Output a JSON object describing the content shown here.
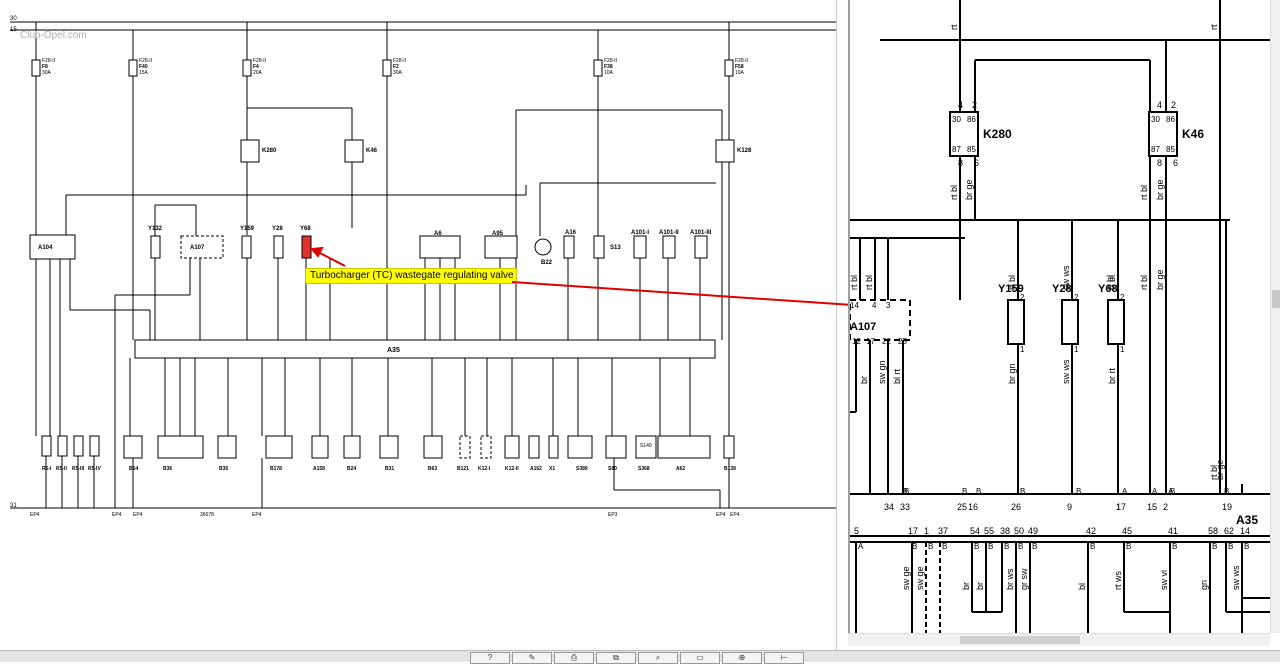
{
  "callout": {
    "text": "Turbocharger (TC) wastegate regulating valve",
    "color": "#ffff00",
    "arrow_color": "#e00000"
  },
  "watermark": "Club-Opel.com",
  "left": {
    "rails": [
      "30",
      "15"
    ],
    "ground_rail": "31",
    "fuses": [
      {
        "id": "F8",
        "sub": "30A",
        "top": "F28-II"
      },
      {
        "id": "F40",
        "sub": "15A",
        "top": "F28-II"
      },
      {
        "id": "F4",
        "sub": "20A",
        "top": "F28-II"
      },
      {
        "id": "F2",
        "sub": "30A",
        "top": "F28-II"
      },
      {
        "id": "F38",
        "sub": "10A",
        "top": "F28-II"
      },
      {
        "id": "F58",
        "sub": "10A",
        "top": "F28-II"
      }
    ],
    "relays": [
      "K280",
      "K46",
      "K128"
    ],
    "components": [
      "A104",
      "Y132",
      "A107",
      "Y159",
      "Y28",
      "Y68",
      "A6",
      "A95",
      "B22",
      "A16",
      "S13",
      "A101-I",
      "A101-II",
      "A101-III"
    ],
    "ecu": "A35",
    "bottom_components": [
      "R5-I",
      "R5-II",
      "R5-III",
      "R5-IV",
      "B64",
      "B36",
      "B35",
      "B178",
      "A158",
      "B24",
      "B31",
      "B63",
      "B121",
      "K12-I",
      "K12-II",
      "A162",
      "X1",
      "S389",
      "S80",
      "S368",
      "A62",
      "B138",
      "B64"
    ],
    "bottom_small": [
      "S149"
    ],
    "ground_labels": [
      "EP4",
      "EP4",
      "EP4",
      "EP4",
      "EP3",
      "EP4",
      "EP4"
    ],
    "misc_label": "36678"
  },
  "right": {
    "relays": [
      {
        "id": "K280",
        "pins": [
          "4",
          "2",
          "30",
          "86",
          "87",
          "85",
          "8",
          "6"
        ]
      },
      {
        "id": "K46",
        "pins": [
          "4",
          "2",
          "30",
          "86",
          "87",
          "85",
          "8",
          "6"
        ]
      }
    ],
    "wire_colors_top": [
      "rt",
      "rt"
    ],
    "wire_colors_mid": [
      "rt bl",
      "br ge",
      "rt bl",
      "br ge"
    ],
    "components": [
      {
        "id": "Y159",
        "top_pin": "2",
        "bottom_pin": "1",
        "wire_top": "rt bl",
        "wire_bottom": "br gn"
      },
      {
        "id": "Y28",
        "top_pin": "2",
        "bottom_pin": "1",
        "wire_top": "sw ws",
        "wire_bottom": "sw ws"
      },
      {
        "id": "Y68",
        "top_pin": "2",
        "bottom_pin": "1",
        "wire_top": "rt bl",
        "wire_bottom": "br rt"
      }
    ],
    "a107": {
      "id": "A107",
      "pins_top": [
        "14",
        "4",
        "3"
      ],
      "pins_bottom": [
        "12",
        "17",
        "22",
        "25"
      ]
    },
    "left_wires": [
      "rt bl",
      "rt bl",
      "br",
      "sw gn",
      "bl rt"
    ],
    "ecu": "A35",
    "ecu_row_top": [
      "34",
      "33",
      "25",
      "16",
      "26",
      "9",
      "17",
      "1",
      "15",
      "2",
      "19"
    ],
    "ecu_row_top_conn": [
      "B",
      "B",
      "B",
      "B",
      "B",
      "B",
      "A",
      "B",
      "A",
      "A",
      "B"
    ],
    "ecu_row_bottom": [
      "5",
      "17",
      "1",
      "37",
      "54",
      "55",
      "38",
      "50",
      "49",
      "42",
      "45",
      "41",
      "58",
      "62",
      "14"
    ],
    "ecu_row_bottom_conn": [
      "A",
      "B",
      "B",
      "B",
      "B",
      "B",
      "B",
      "B",
      "B",
      "B",
      "B",
      "B",
      "B",
      "B",
      "B"
    ],
    "bottom_wires": [
      "sw ge",
      "sw ge",
      "br",
      "br",
      "br ws",
      "gr sw",
      "bl",
      "rt ws",
      "sw vi",
      "gn",
      "sw ws"
    ],
    "right_wires": [
      "rt bl",
      "rt bl",
      "br ge",
      "rt bl",
      "br ge"
    ]
  },
  "toolbar": {
    "buttons": [
      "help-icon",
      "edit-icon",
      "print-icon",
      "copy-icon",
      "zoom-icon",
      "fit-icon",
      "target-icon",
      "measure-icon"
    ]
  }
}
